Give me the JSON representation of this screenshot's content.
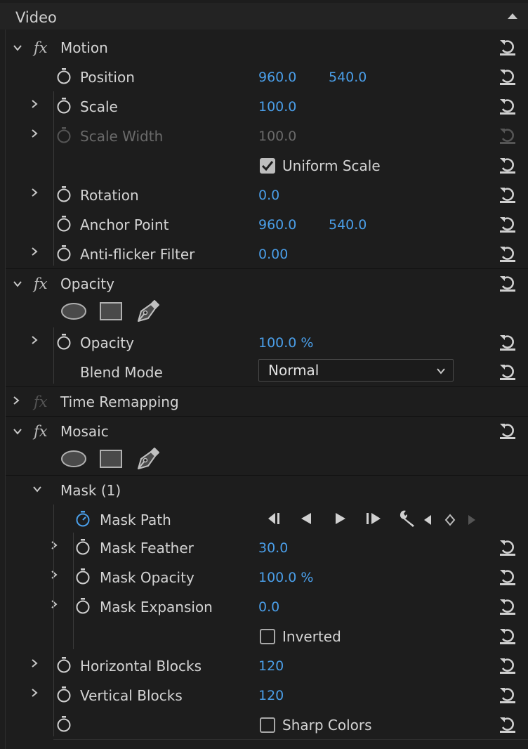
{
  "section": {
    "title": "Video"
  },
  "motion": {
    "title": "Motion",
    "position": {
      "label": "Position",
      "x": "960.0",
      "y": "540.0"
    },
    "scale": {
      "label": "Scale",
      "value": "100.0"
    },
    "scale_width": {
      "label": "Scale Width",
      "value": "100.0"
    },
    "uniform_scale": {
      "label": "Uniform Scale",
      "checked": true
    },
    "rotation": {
      "label": "Rotation",
      "value": "0.0"
    },
    "anchor_point": {
      "label": "Anchor Point",
      "x": "960.0",
      "y": "540.0"
    },
    "anti_flicker": {
      "label": "Anti-flicker Filter",
      "value": "0.00"
    }
  },
  "opacity": {
    "title": "Opacity",
    "opacity": {
      "label": "Opacity",
      "value": "100.0 %"
    },
    "blend_mode": {
      "label": "Blend Mode",
      "value": "Normal"
    }
  },
  "time_remapping": {
    "title": "Time Remapping"
  },
  "mosaic": {
    "title": "Mosaic",
    "mask": {
      "title": "Mask (1)",
      "mask_path": {
        "label": "Mask Path"
      },
      "mask_feather": {
        "label": "Mask Feather",
        "value": "30.0"
      },
      "mask_opacity": {
        "label": "Mask Opacity",
        "value": "100.0 %"
      },
      "mask_expansion": {
        "label": "Mask Expansion",
        "value": "0.0"
      },
      "inverted": {
        "label": "Inverted",
        "checked": false
      }
    },
    "horizontal_blocks": {
      "label": "Horizontal Blocks",
      "value": "120"
    },
    "vertical_blocks": {
      "label": "Vertical Blocks",
      "value": "120"
    },
    "sharp_colors": {
      "label": "Sharp Colors",
      "checked": false
    }
  },
  "icons": {
    "expand": "chevron-right-icon",
    "collapse": "chevron-down-icon",
    "stopwatch": "stopwatch-icon",
    "reset": "reset-icon",
    "fx": "fx-icon",
    "ellipse_mask": "ellipse-mask-icon",
    "rect_mask": "rectangle-mask-icon",
    "pen_mask": "pen-mask-icon",
    "track_back": "track-backward-one-icon",
    "track_back_play": "track-backward-icon",
    "track_fwd_play": "track-forward-icon",
    "track_fwd": "track-forward-one-icon",
    "wrench": "wrench-icon"
  },
  "colors": {
    "value_blue": "#4a9ee8",
    "background": "#1d1d1d",
    "header": "#232323"
  }
}
